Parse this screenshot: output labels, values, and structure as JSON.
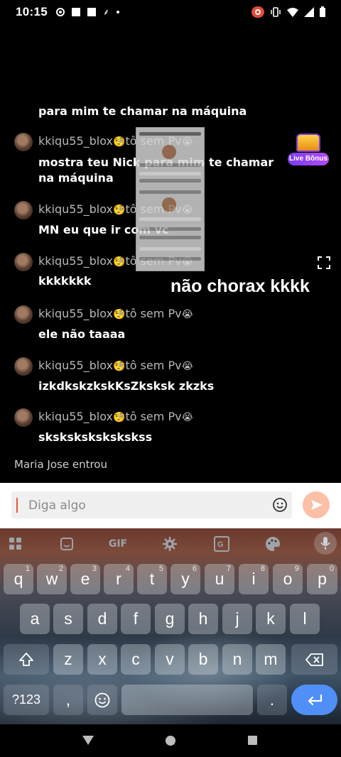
{
  "status_bar": {
    "time": "10:15",
    "left_icons": [
      "at-sign-icon",
      "square-icon",
      "square-icon",
      "glyph-icon",
      "dot-icon"
    ],
    "right_icons": [
      "screen-record-icon",
      "vibrate-icon",
      "wifi-icon",
      "signal-icon",
      "battery-icon"
    ]
  },
  "chat": {
    "partial_message": "para mim te chamar na máquina",
    "messages": [
      {
        "user": "kkiqu55_blox",
        "emoji": "🧐",
        "tag": "tô sem Pv",
        "tag_emoji": "😭",
        "text": "mostra teu Nick para mim te chamar na máquina"
      },
      {
        "user": "kkiqu55_blox",
        "emoji": "🧐",
        "tag": "tô sem Pv",
        "tag_emoji": "😭",
        "text": "MN eu que ir com vc"
      },
      {
        "user": "kkiqu55_blox",
        "emoji": "🧐",
        "tag": "tô sem Pv",
        "tag_emoji": "😭",
        "text": "kkkkkkk"
      },
      {
        "user": "kkiqu55_blox",
        "emoji": "🧐",
        "tag": "tô sem Pv",
        "tag_emoji": "😭",
        "text": "ele não taaaa"
      },
      {
        "user": "kkiqu55_blox",
        "emoji": "🧐",
        "tag": "tô sem Pv",
        "tag_emoji": "😭",
        "text": "izkdkskzkskKsZksksk zkzks"
      },
      {
        "user": "kkiqu55_blox",
        "emoji": "🧐",
        "tag": "tô sem Pv",
        "tag_emoji": "😭",
        "text": "skskskskskskskss"
      }
    ],
    "system_message": "Maria Jose entrou"
  },
  "overlay": {
    "bonus_label": "Live Bônus",
    "caption": "não chorax kkkk"
  },
  "input": {
    "placeholder": "Diga algo",
    "value": ""
  },
  "keyboard": {
    "toolbar": [
      "apps-icon",
      "sticker-icon",
      "GIF",
      "settings-icon",
      "translate-icon",
      "palette-icon",
      "mic-icon"
    ],
    "row1": [
      {
        "key": "q",
        "hint": "1"
      },
      {
        "key": "w",
        "hint": "2"
      },
      {
        "key": "e",
        "hint": "3"
      },
      {
        "key": "r",
        "hint": "4"
      },
      {
        "key": "t",
        "hint": "5"
      },
      {
        "key": "y",
        "hint": "6"
      },
      {
        "key": "u",
        "hint": "7"
      },
      {
        "key": "i",
        "hint": "8"
      },
      {
        "key": "o",
        "hint": "9"
      },
      {
        "key": "p",
        "hint": "0"
      }
    ],
    "row2": [
      "a",
      "s",
      "d",
      "f",
      "g",
      "h",
      "j",
      "k",
      "l"
    ],
    "row3": [
      "z",
      "x",
      "c",
      "v",
      "b",
      "n",
      "m"
    ],
    "bottom": {
      "symbols": "?123",
      "comma": ",",
      "period": "."
    }
  },
  "colors": {
    "accent": "#e8563a",
    "send_button": "#fbc0a6",
    "enter_key": "#4f8ff7",
    "bonus_badge": "#7b3cf0"
  }
}
